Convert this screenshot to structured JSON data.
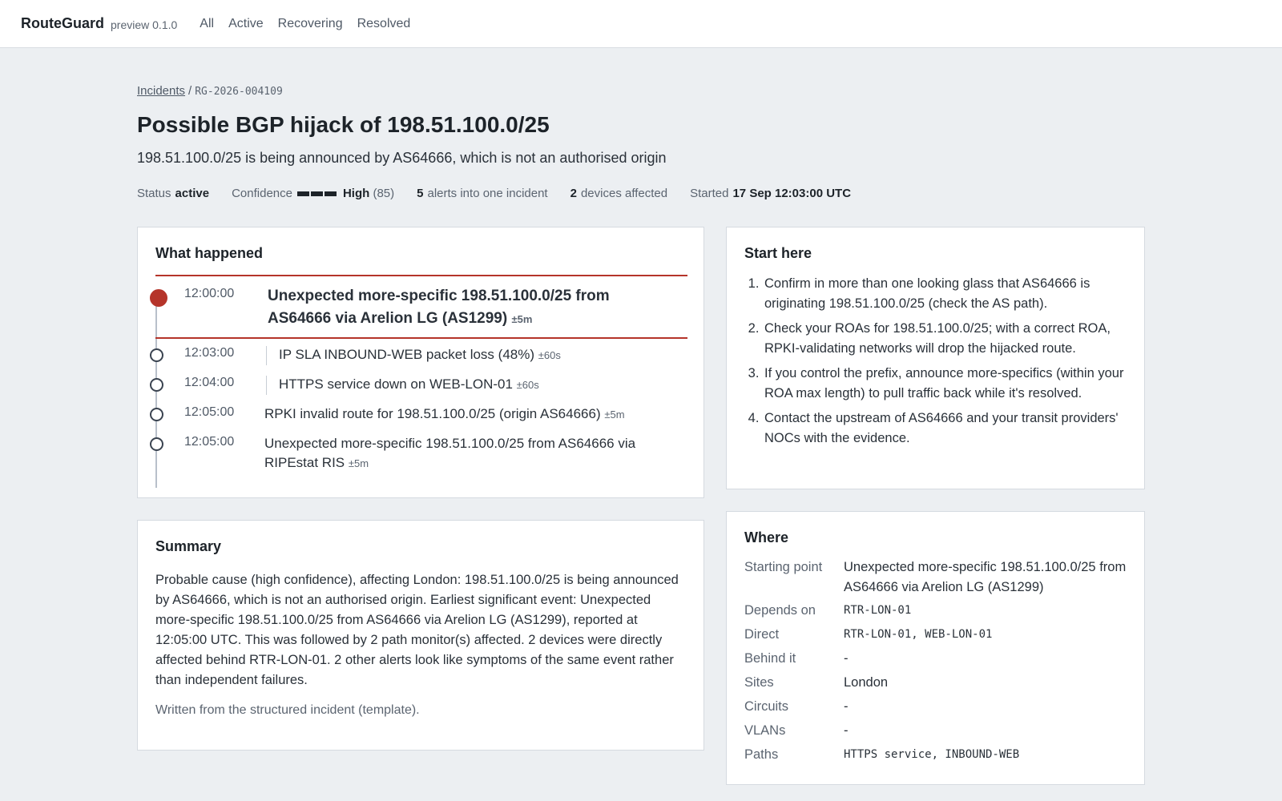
{
  "app": {
    "brand": "RouteGuard",
    "version": "preview 0.1.0"
  },
  "nav": [
    "All",
    "Active",
    "Recovering",
    "Resolved"
  ],
  "breadcrumb": {
    "parent": "Incidents",
    "separator": "/",
    "id": "RG-2026-004109"
  },
  "incident": {
    "title": "Possible BGP hijack of 198.51.100.0/25",
    "subtitle": "198.51.100.0/25 is being announced by AS64666, which is not an authorised origin",
    "meta": {
      "status_label": "Status",
      "status_value": "active",
      "confidence_label": "Confidence",
      "confidence_value": "High",
      "confidence_score": "(85)",
      "confidence_level": 3,
      "alerts_count": "5",
      "alerts_text": "alerts into one incident",
      "devices_count": "2",
      "devices_text": "devices affected",
      "started_label": "Started",
      "started_value": "17 Sep 12:03:00 UTC"
    }
  },
  "what_happened": {
    "heading": "What happened",
    "events": [
      {
        "time": "12:00:00",
        "text": "Unexpected more-specific 198.51.100.0/25 from AS64666 via Arelion LG (AS1299)",
        "tolerance": "±5m"
      },
      {
        "time": "12:03:00",
        "text": "IP SLA INBOUND-WEB packet loss (48%)",
        "tolerance": "±60s"
      },
      {
        "time": "12:04:00",
        "text": "HTTPS service down on WEB-LON-01",
        "tolerance": "±60s"
      },
      {
        "time": "12:05:00",
        "text": "RPKI invalid route for 198.51.100.0/25 (origin AS64666)",
        "tolerance": "±5m"
      },
      {
        "time": "12:05:00",
        "text": "Unexpected more-specific 198.51.100.0/25 from AS64666 via RIPEstat RIS",
        "tolerance": "±5m"
      }
    ]
  },
  "start_here": {
    "heading": "Start here",
    "steps": [
      "Confirm in more than one looking glass that AS64666 is originating 198.51.100.0/25 (check the AS path).",
      "Check your ROAs for 198.51.100.0/25; with a correct ROA, RPKI-validating networks will drop the hijacked route.",
      "If you control the prefix, announce more-specifics (within your ROA max length) to pull traffic back while it's resolved.",
      "Contact the upstream of AS64666 and your transit providers' NOCs with the evidence."
    ]
  },
  "summary": {
    "heading": "Summary",
    "body": "Probable cause (high confidence), affecting London: 198.51.100.0/25 is being announced by AS64666, which is not an authorised origin. Earliest significant event: Unexpected more-specific 198.51.100.0/25 from AS64666 via Arelion LG (AS1299), reported at 12:05:00 UTC. This was followed by 2 path monitor(s) affected. 2 devices were directly affected behind RTR-LON-01. 2 other alerts look like symptoms of the same event rather than independent failures.",
    "note": "Written from the structured incident (template)."
  },
  "where": {
    "heading": "Where",
    "rows": [
      {
        "key": "Starting point",
        "value": "Unexpected more-specific 198.51.100.0/25 from AS64666 via Arelion LG (AS1299)"
      },
      {
        "key": "Depends on",
        "value": "RTR-LON-01"
      },
      {
        "key": "Direct",
        "value": "RTR-LON-01, WEB-LON-01"
      },
      {
        "key": "Behind it",
        "value": "-"
      },
      {
        "key": "Sites",
        "value": "London"
      },
      {
        "key": "Circuits",
        "value": "-"
      },
      {
        "key": "VLANs",
        "value": "-"
      },
      {
        "key": "Paths",
        "value": "HTTPS service, INBOUND-WEB"
      }
    ]
  },
  "colors": {
    "accent": "#b5342a",
    "background": "#eceff2",
    "card": "#ffffff",
    "text": "#1d2329",
    "muted": "#5b6470"
  },
  "icons": {
    "timeline_current": "filled-dot-icon",
    "timeline_event": "hollow-dot-icon",
    "confidence": "confidence-bars-icon"
  }
}
